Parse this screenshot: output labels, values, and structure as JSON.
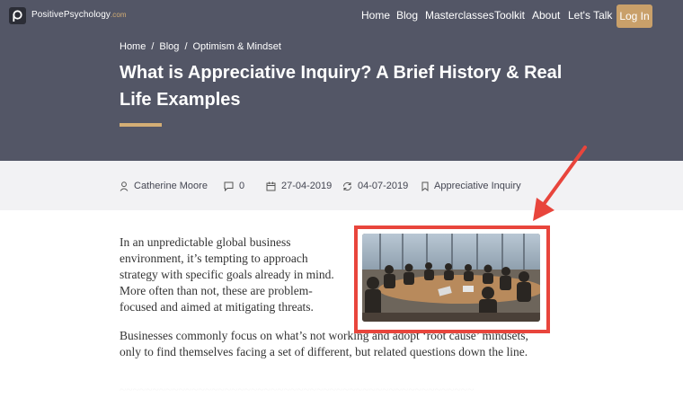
{
  "brand": {
    "name": "PositivePsychology",
    "suffix": ".com"
  },
  "nav": {
    "links": [
      "Home",
      "Blog",
      "Masterclasses",
      "Toolkit",
      "About",
      "Let's Talk"
    ],
    "login": "Log In"
  },
  "breadcrumb": [
    "Home",
    "Blog",
    "Optimism & Mindset"
  ],
  "article": {
    "title": "What is Appreciative Inquiry? A Brief History & Real Life Examples",
    "author": "Catherine Moore",
    "comments": "0",
    "published": "27-04-2019",
    "updated": "04-07-2019",
    "category": "Appreciative Inquiry",
    "paragraphs": [
      "In an unpredictable global business environment, it’s tempting to approach strategy with specific goals already in mind. More often than not, these are problem-focused and aimed at mitigating threats.",
      "Businesses commonly focus on what’s not working and adopt ‘root cause’ mindsets, only to find themselves facing a set of different, but related questions down the line.",
      "~~~~~~~~~~~~~~~~~~~~~~~~~~~~~~~~~~~~~~~~~~~~~~~~~~~~~~"
    ]
  },
  "colors": {
    "hero": "#535666",
    "accent": "#d4ae75",
    "button": "#c9a06a",
    "highlight": "#e8453c",
    "meta_bar": "#f2f2f4"
  },
  "icons": [
    "logo-icon",
    "user-icon",
    "comment-icon",
    "calendar-icon",
    "refresh-icon",
    "bookmark-icon",
    "arrow-icon"
  ]
}
